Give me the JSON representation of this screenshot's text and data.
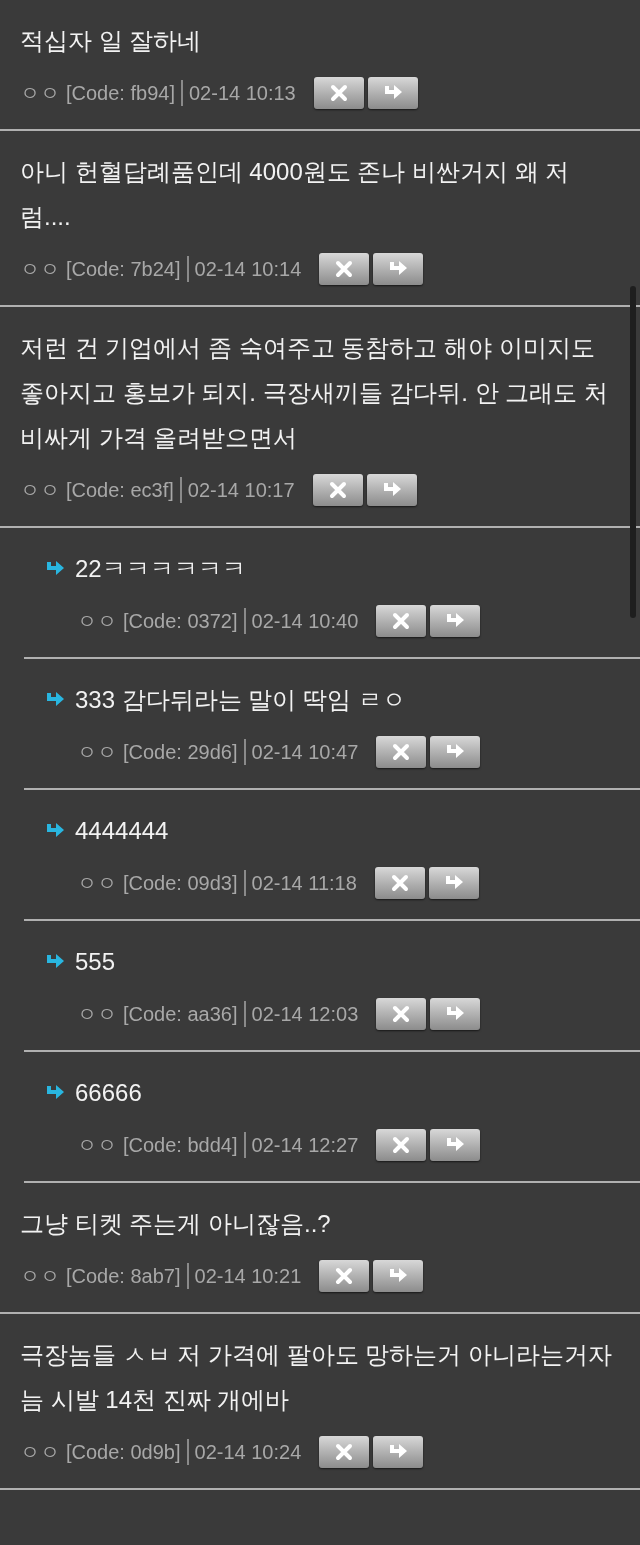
{
  "comments": [
    {
      "text": "적십자 일 잘하네",
      "author": "ㅇㅇ",
      "code": "[Code: fb94]",
      "time": "02-14 10:13"
    },
    {
      "text": "아니 헌혈답례품인데 4000원도 존나 비싼거지 왜 저럼....",
      "author": "ㅇㅇ",
      "code": "[Code: 7b24]",
      "time": "02-14 10:14"
    },
    {
      "text": "저런 건 기업에서 좀 숙여주고 동참하고 해야 이미지도 좋아지고 홍보가 되지. 극장새끼들 감다뒤. 안 그래도 처 비싸게 가격 올려받으면서",
      "author": "ㅇㅇ",
      "code": "[Code: ec3f]",
      "time": "02-14 10:17",
      "children": [
        {
          "text": "22ㅋㅋㅋㅋㅋㅋ",
          "author": "ㅇㅇ",
          "code": "[Code: 0372]",
          "time": "02-14 10:40"
        },
        {
          "text": "333 감다뒤라는 말이 딱임 ㄹㅇ",
          "author": "ㅇㅇ",
          "code": "[Code: 29d6]",
          "time": "02-14 10:47"
        },
        {
          "text": "4444444",
          "author": "ㅇㅇ",
          "code": "[Code: 09d3]",
          "time": "02-14 11:18"
        },
        {
          "text": "555",
          "author": "ㅇㅇ",
          "code": "[Code: aa36]",
          "time": "02-14 12:03"
        },
        {
          "text": "66666",
          "author": "ㅇㅇ",
          "code": "[Code: bdd4]",
          "time": "02-14 12:27"
        }
      ]
    },
    {
      "text": "그냥 티켓 주는게 아니잖음..?",
      "author": "ㅇㅇ",
      "code": "[Code: 8ab7]",
      "time": "02-14 10:21"
    },
    {
      "text": "극장놈들 ㅅㅂ 저 가격에 팔아도 망하는거 아니라는거자늠 시발 14천 진짜 개에바",
      "author": "ㅇㅇ",
      "code": "[Code: 0d9b]",
      "time": "02-14 10:24"
    }
  ]
}
